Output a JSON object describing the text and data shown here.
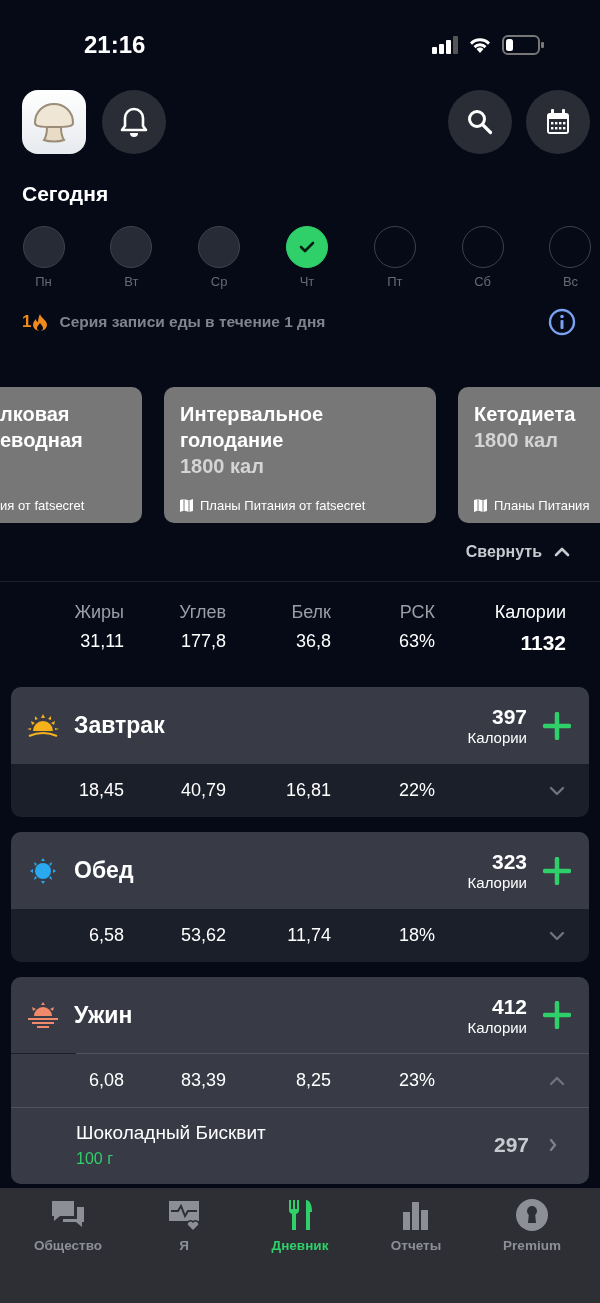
{
  "status_bar": {
    "time": "21:16"
  },
  "header": {
    "title": "Сегодня"
  },
  "week": [
    {
      "label": "Пн",
      "kind": "past"
    },
    {
      "label": "Вт",
      "kind": "past"
    },
    {
      "label": "Ср",
      "kind": "past"
    },
    {
      "label": "Чт",
      "kind": "logged"
    },
    {
      "label": "Пт",
      "kind": "future"
    },
    {
      "label": "Сб",
      "kind": "future"
    },
    {
      "label": "Вс",
      "kind": "future"
    }
  ],
  "streak": {
    "count": "1",
    "text": "Серия записи еды в течение 1 дня"
  },
  "plans": [
    {
      "title_lines": [
        "лковая",
        "еводная"
      ],
      "source": "ия от fatsecret",
      "kind": "cut_left"
    },
    {
      "title_lines": [
        "Интервальное",
        "голодание"
      ],
      "calories": "1800 кал",
      "source": "Планы Питания от fatsecret",
      "kind": "full"
    },
    {
      "title_lines": [
        "Кетодиета"
      ],
      "calories": "1800 кал",
      "source": "Планы Питания",
      "kind": "cut_right"
    }
  ],
  "collapse": {
    "label": "Свернуть"
  },
  "summary": {
    "columns": [
      "Жиры",
      "Углев",
      "Белк",
      "РСК",
      "Калории"
    ],
    "values": [
      "31,11",
      "177,8",
      "36,8",
      "63%",
      "1132"
    ]
  },
  "meals": [
    {
      "name": "Завтрак",
      "kind": "sunrise",
      "calories": "397",
      "calories_label": "Калории",
      "macros": [
        "18,45",
        "40,79",
        "16,81",
        "22%"
      ],
      "expanded": false
    },
    {
      "name": "Обед",
      "kind": "sun",
      "calories": "323",
      "calories_label": "Калории",
      "macros": [
        "6,58",
        "53,62",
        "11,74",
        "18%"
      ],
      "expanded": false
    },
    {
      "name": "Ужин",
      "kind": "sunset",
      "calories": "412",
      "calories_label": "Калории",
      "macros": [
        "6,08",
        "83,39",
        "8,25",
        "23%"
      ],
      "expanded": true,
      "items": [
        {
          "name": "Шоколадный Бисквит",
          "amount": "100 г",
          "calories": "297"
        }
      ]
    }
  ],
  "tabs": [
    {
      "label": "Общество",
      "kind": "chat",
      "selected": false
    },
    {
      "label": "Я",
      "kind": "health",
      "selected": false
    },
    {
      "label": "Дневник",
      "kind": "diary",
      "selected": true
    },
    {
      "label": "Отчеты",
      "kind": "reports",
      "selected": false
    },
    {
      "label": "Premium",
      "kind": "premium",
      "selected": false
    }
  ]
}
